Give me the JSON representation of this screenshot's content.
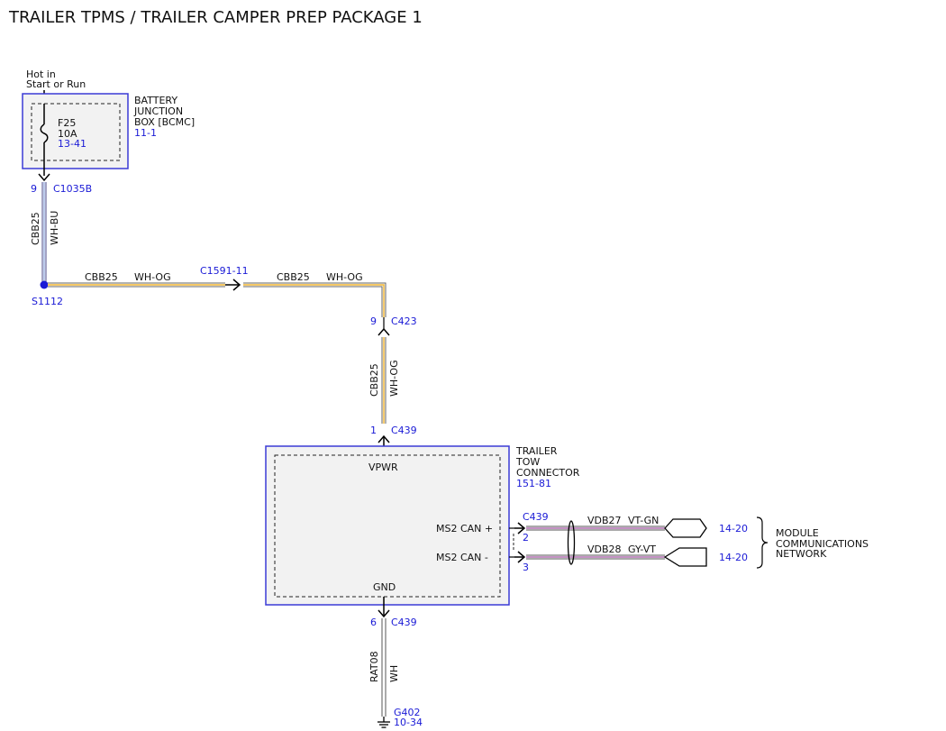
{
  "title": "TRAILER TPMS / TRAILER CAMPER PREP PACKAGE 1",
  "colors": {
    "link_blue": "#1a1ad6",
    "box_border": "#3b3bd6",
    "box_fill": "#f2f2f2",
    "wire_orange": "#f2b632",
    "wire_violet": "#b06fb0",
    "wire_blue": "#8ea8e0"
  },
  "power": {
    "hot_line1": "Hot in",
    "hot_line2": "Start or Run"
  },
  "bjb": {
    "name_line1": "BATTERY",
    "name_line2": "JUNCTION",
    "name_line3": "BOX [BCMC]",
    "ref": "11-1",
    "fuse_id": "F25",
    "fuse_rating": "10A",
    "fuse_ref": "13-41"
  },
  "c1035b": {
    "pin": "9",
    "name": "C1035B"
  },
  "wire_vert1": {
    "circuit": "CBB25",
    "color": "WH-BU"
  },
  "splice": {
    "name": "S1112"
  },
  "wire_h1": {
    "circuit": "CBB25",
    "color": "WH-OG"
  },
  "c1591": {
    "name": "C1591-11"
  },
  "wire_h2": {
    "circuit": "CBB25",
    "color": "WH-OG"
  },
  "c423": {
    "pin": "9",
    "name": "C423"
  },
  "wire_vert2": {
    "circuit": "CBB25",
    "color": "WH-OG"
  },
  "c439_top": {
    "pin": "1",
    "name": "C439"
  },
  "ttc": {
    "name_line1": "TRAILER",
    "name_line2": "TOW",
    "name_line3": "CONNECTOR",
    "ref": "151-81",
    "vpwr": "VPWR",
    "ms2_plus": "MS2 CAN +",
    "ms2_minus": "MS2 CAN -",
    "gnd": "GND"
  },
  "c439_can": {
    "name": "C439",
    "pin_plus": "2",
    "pin_minus": "3"
  },
  "can_plus_wire": {
    "circuit": "VDB27",
    "color": "VT-GN",
    "ref": "14-20"
  },
  "can_minus_wire": {
    "circuit": "VDB28",
    "color": "GY-VT",
    "ref": "14-20"
  },
  "network": {
    "line1": "MODULE",
    "line2": "COMMUNICATIONS",
    "line3": "NETWORK"
  },
  "c439_bottom": {
    "pin": "6",
    "name": "C439"
  },
  "wire_gnd": {
    "circuit": "RAT08",
    "color": "WH"
  },
  "ground": {
    "name": "G402",
    "ref": "10-34"
  }
}
